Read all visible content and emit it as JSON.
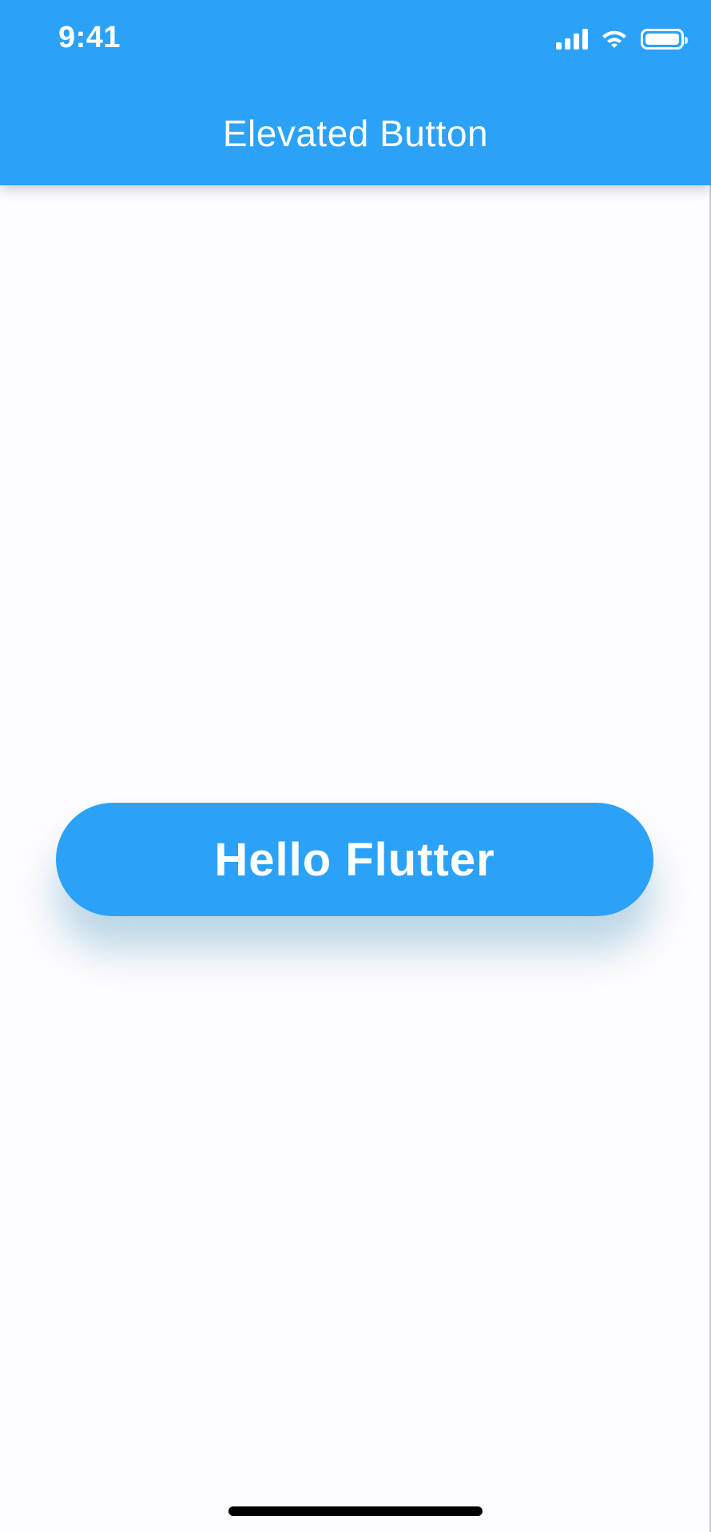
{
  "status_bar": {
    "time": "9:41",
    "icons": [
      "cellular-signal-icon",
      "wifi-icon",
      "battery-icon"
    ]
  },
  "app_bar": {
    "title": "Elevated Button",
    "background_color": "#2BA2F8"
  },
  "main": {
    "button_label": "Hello Flutter",
    "button_color": "#2BA2F8"
  },
  "colors": {
    "accent": "#2BA2F8",
    "page_background": "#FDFCFE",
    "text_on_accent": "#FFFFFF"
  }
}
